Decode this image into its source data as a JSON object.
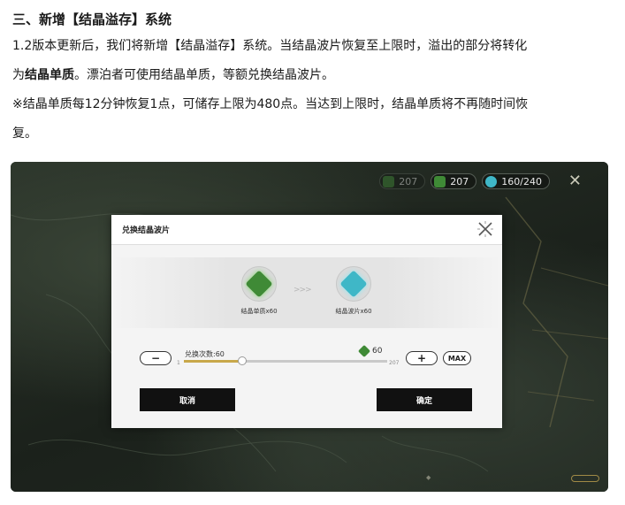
{
  "article": {
    "heading": "三、新增【结晶溢存】系统",
    "p1_a": "1.2版本更新后，我们将新增【结晶溢存】系统。当结晶波片恢复至上限时，溢出的部分将转化",
    "p1_b_prefix": "为",
    "p1_b_bold": "结晶单质",
    "p1_b_suffix": "。漂泊者可使用结晶单质，等额兑换结晶波片。",
    "p2_a": "※结晶单质每12分钟恢复1点，可储存上限为480点。当达到上限时，结晶单质将不再随时间恢",
    "p2_b": "复。"
  },
  "game": {
    "hud": {
      "crystal_solvent_count": "207",
      "waveplate_count": "160/240",
      "crystal_solvent_count_bg": "207"
    },
    "dialog": {
      "title": "兑换结晶波片",
      "from_item_label": "结晶单质x60",
      "to_item_label": "结晶波片x60",
      "arrows": ">>>",
      "count_label": "兑换次数:60",
      "slider_min": "1",
      "slider_max": "207",
      "slider_value": 60,
      "cost_value": "60",
      "minus_label": "−",
      "plus_label": "+",
      "max_label": "MAX",
      "cancel_label": "取消",
      "confirm_label": "确定"
    },
    "colors": {
      "solvent_green": "#3f8a36",
      "waveplate_cyan": "#3fb7c7",
      "slider_fill": "#c8a84a"
    }
  }
}
